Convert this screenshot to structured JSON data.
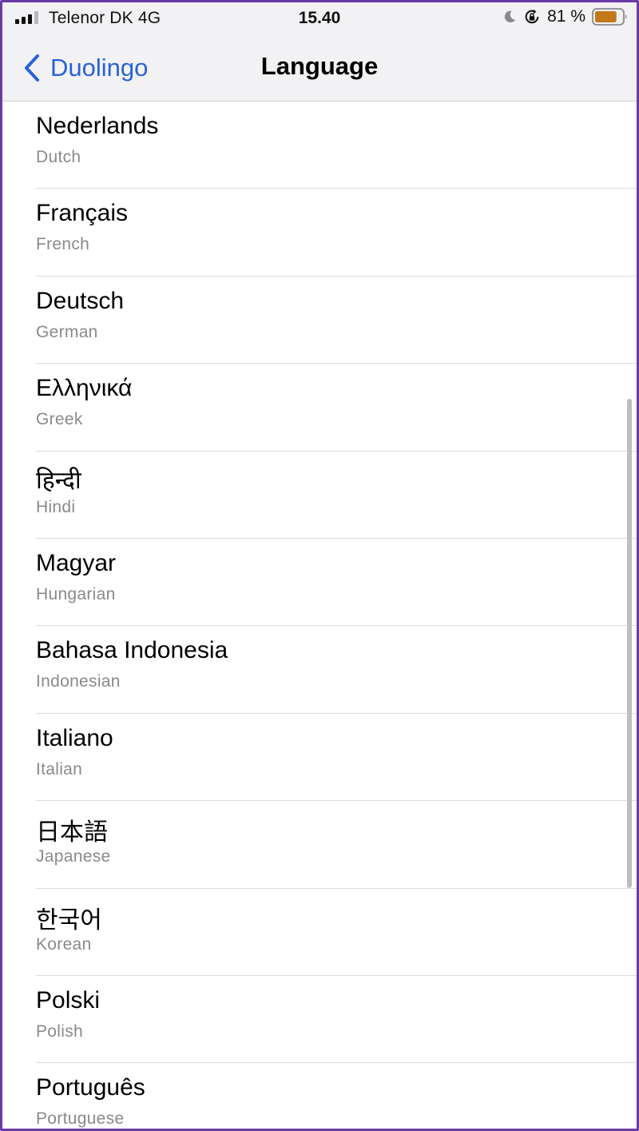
{
  "status_bar": {
    "carrier": "Telenor DK   4G",
    "time": "15.40",
    "battery_percent": "81 %",
    "battery_level": 0.81,
    "battery_color": "#c07a1a",
    "icons": [
      "signal-icon",
      "moon-icon",
      "orientation-lock-icon",
      "battery-icon"
    ]
  },
  "nav": {
    "back_label": "Duolingo",
    "title": "Language",
    "accent_color": "#2a62d8"
  },
  "languages": [
    {
      "native": "Nederlands",
      "english": "Dutch"
    },
    {
      "native": "Français",
      "english": "French"
    },
    {
      "native": "Deutsch",
      "english": "German"
    },
    {
      "native": "Ελληνικά",
      "english": "Greek"
    },
    {
      "native": "हिन्दी",
      "english": "Hindi"
    },
    {
      "native": "Magyar",
      "english": "Hungarian"
    },
    {
      "native": "Bahasa Indonesia",
      "english": "Indonesian"
    },
    {
      "native": "Italiano",
      "english": "Italian"
    },
    {
      "native": "日本語",
      "english": "Japanese"
    },
    {
      "native": "한국어",
      "english": "Korean"
    },
    {
      "native": "Polski",
      "english": "Polish"
    },
    {
      "native": "Português",
      "english": "Portuguese"
    }
  ]
}
